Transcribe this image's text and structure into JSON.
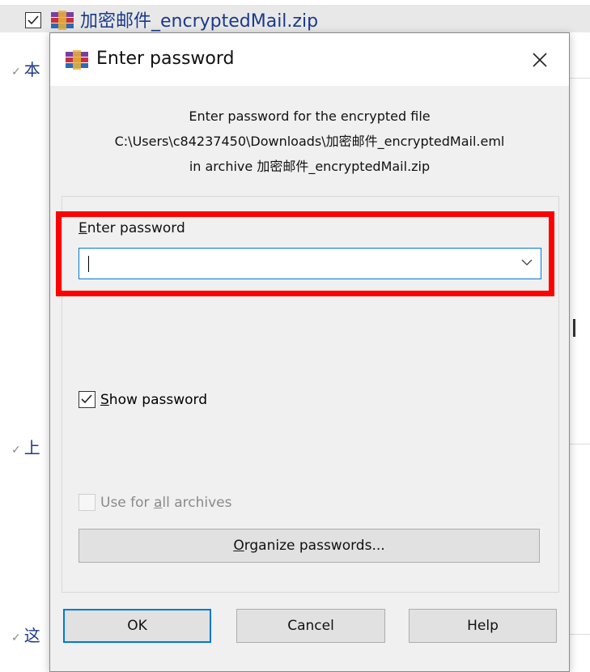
{
  "background": {
    "file_name": "加密邮件_encryptedMail.zip",
    "side_labels": [
      "本",
      "上",
      "这"
    ]
  },
  "dialog": {
    "title": "Enter password",
    "close_glyph": "✕",
    "info_line1": "Enter password for the encrypted file",
    "info_line2": "C:\\Users\\c84237450\\Downloads\\加密邮件_encryptedMail.eml",
    "info_line3": "in archive 加密邮件_encryptedMail.zip",
    "password_label_accel": "E",
    "password_label_rest": "nter password",
    "password_value": "",
    "show_password": {
      "accel": "S",
      "rest": "how password",
      "checked": true
    },
    "use_for_all": {
      "before": "Use for ",
      "accel": "a",
      "after": "ll archives",
      "checked": false,
      "disabled": true
    },
    "organize_button": {
      "accel": "O",
      "rest": "rganize passwords..."
    },
    "ok_label": "OK",
    "cancel_label": "Cancel",
    "help_label": "Help"
  },
  "icons": {
    "app_icon": "winrar-icon",
    "close": "close-icon",
    "dropdown": "chevron-down-icon",
    "check": "checkmark-icon"
  },
  "colors": {
    "highlight_box": "#ff0000",
    "focus_border": "#0078d7",
    "dialog_bg": "#f0f0f0"
  }
}
